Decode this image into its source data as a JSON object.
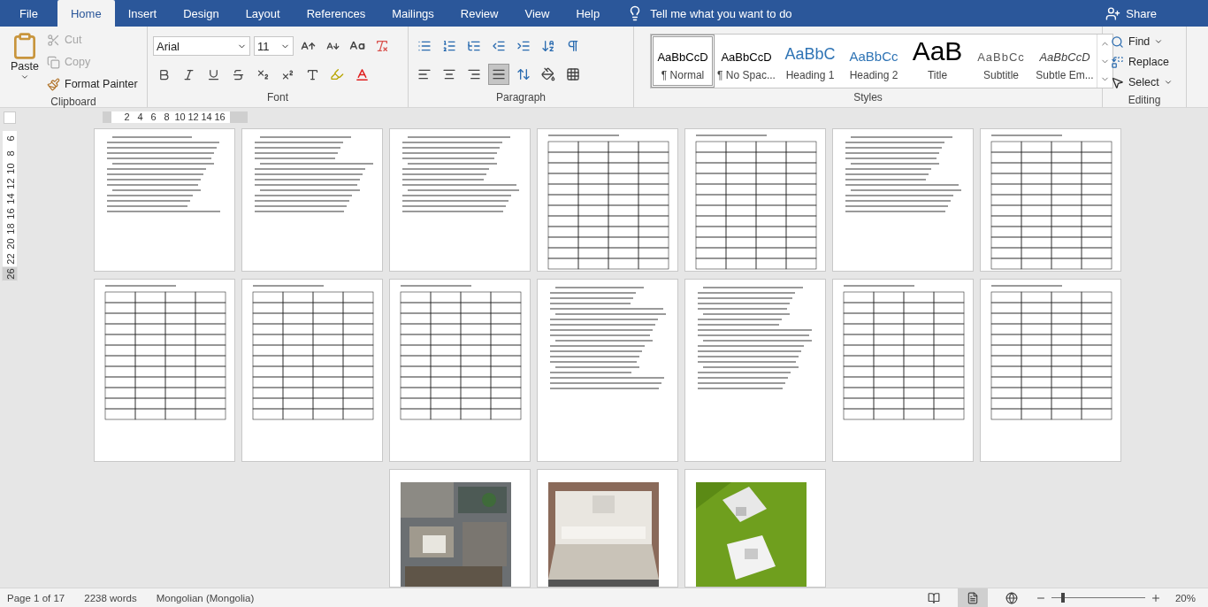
{
  "menu_tabs": [
    {
      "label": "File",
      "selected": false,
      "kind": "file"
    },
    {
      "label": "Home",
      "selected": true
    },
    {
      "label": "Insert",
      "selected": false
    },
    {
      "label": "Design",
      "selected": false
    },
    {
      "label": "Layout",
      "selected": false
    },
    {
      "label": "References",
      "selected": false
    },
    {
      "label": "Mailings",
      "selected": false
    },
    {
      "label": "Review",
      "selected": false
    },
    {
      "label": "View",
      "selected": false
    },
    {
      "label": "Help",
      "selected": false
    }
  ],
  "tell_me": {
    "placeholder": "Tell me what you want to do"
  },
  "share": "Share",
  "clipboard": {
    "label": "Clipboard",
    "paste": "Paste",
    "cut": {
      "label": "Cut",
      "disabled": true
    },
    "copy": {
      "label": "Copy",
      "disabled": true
    },
    "format_painter": {
      "label": "Format Painter",
      "disabled": false
    }
  },
  "font": {
    "label": "Font",
    "name": "Arial",
    "size": "11"
  },
  "paragraph": {
    "label": "Paragraph",
    "alignments": [
      {
        "kind": "left",
        "selected": false
      },
      {
        "kind": "center",
        "selected": false
      },
      {
        "kind": "right",
        "selected": false
      },
      {
        "kind": "justify",
        "selected": true
      }
    ]
  },
  "styles": {
    "label": "Styles",
    "items": [
      {
        "sample": "AaBbCcD",
        "name": "¶ Normal",
        "kind": "normal",
        "selected": true
      },
      {
        "sample": "AaBbCcD",
        "name": "¶ No Spac...",
        "kind": "normal",
        "selected": false
      },
      {
        "sample": "AaBbC",
        "name": "Heading 1",
        "kind": "heading1",
        "selected": false
      },
      {
        "sample": "AaBbCc",
        "name": "Heading 2",
        "kind": "heading2",
        "selected": false
      },
      {
        "sample": "AaB",
        "name": "Title",
        "kind": "title",
        "selected": false
      },
      {
        "sample": "AaBbCc",
        "name": "Subtitle",
        "kind": "subtitle",
        "selected": false
      },
      {
        "sample": "AaBbCcD",
        "name": "Subtle Em...",
        "kind": "emphasis",
        "selected": false
      }
    ]
  },
  "editing": {
    "label": "Editing",
    "find": "Find",
    "replace": "Replace",
    "select": "Select"
  },
  "horizontal_ruler": [
    "2",
    "4",
    "6",
    "8",
    "10",
    "12",
    "14",
    "16"
  ],
  "vertical_ruler": [
    "6",
    "8",
    "10",
    "12",
    "14",
    "16",
    "18",
    "20",
    "22",
    "26"
  ],
  "page_rows": [
    {
      "pages": [
        {
          "kind": "text"
        },
        {
          "kind": "text"
        },
        {
          "kind": "text"
        },
        {
          "kind": "table"
        },
        {
          "kind": "table"
        },
        {
          "kind": "text"
        },
        {
          "kind": "table"
        }
      ]
    },
    {
      "pages": [
        {
          "kind": "table"
        },
        {
          "kind": "table"
        },
        {
          "kind": "table"
        },
        {
          "kind": "text"
        },
        {
          "kind": "text"
        },
        {
          "kind": "table"
        },
        {
          "kind": "table"
        }
      ]
    },
    {
      "pages": [
        {
          "kind": "aerial"
        },
        {
          "kind": "room"
        },
        {
          "kind": "plan"
        }
      ]
    }
  ],
  "status_bar": {
    "page": "Page 1 of 17",
    "words": "2238 words",
    "language": "Mongolian (Mongolia)",
    "views": [
      {
        "kind": "read",
        "selected": false
      },
      {
        "kind": "print",
        "selected": true
      },
      {
        "kind": "web",
        "selected": false
      }
    ],
    "zoom": {
      "level": 0.1,
      "reading": "20%"
    }
  }
}
